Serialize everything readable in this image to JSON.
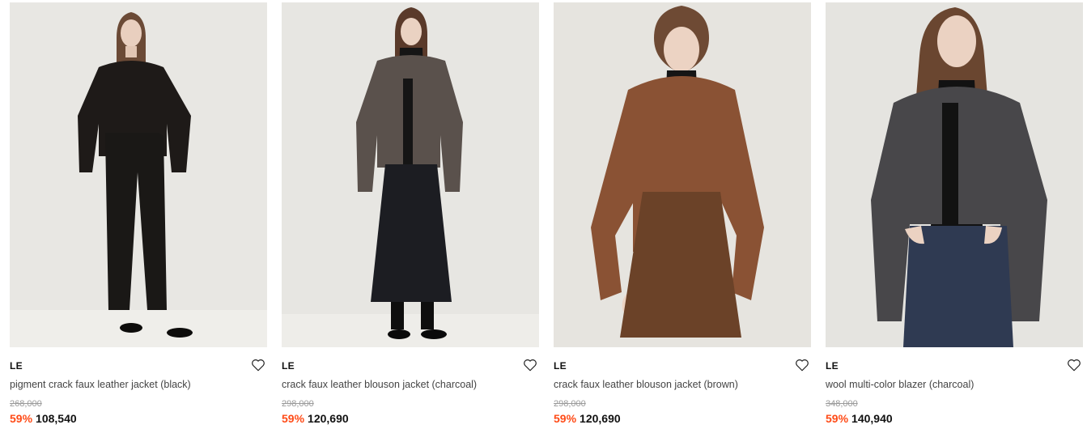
{
  "products": [
    {
      "brand": "LE",
      "name": "pigment crack faux leather jacket (black)",
      "original_price": "268,000",
      "discount": "59%",
      "price": "108,540",
      "wishlist_icon": "heart-outline-icon",
      "jacket_color": "#1e1a18",
      "bottom_color": "#1a1816",
      "backdrop_color": "#e8e7e3"
    },
    {
      "brand": "LE",
      "name": "crack faux leather blouson jacket (charcoal)",
      "original_price": "298,000",
      "discount": "59%",
      "price": "120,690",
      "wishlist_icon": "heart-outline-icon",
      "jacket_color": "#5a514c",
      "bottom_color": "#1c1d22",
      "backdrop_color": "#e7e6e2"
    },
    {
      "brand": "LE",
      "name": "crack faux leather blouson jacket (brown)",
      "original_price": "298,000",
      "discount": "59%",
      "price": "120,690",
      "wishlist_icon": "heart-outline-icon",
      "jacket_color": "#8a5234",
      "bottom_color": "#6b4228",
      "backdrop_color": "#e6e4df"
    },
    {
      "brand": "LE",
      "name": "wool multi-color blazer (charcoal)",
      "original_price": "348,000",
      "discount": "59%",
      "price": "140,940",
      "wishlist_icon": "heart-outline-icon",
      "jacket_color": "#48474a",
      "bottom_color": "#2f3a52",
      "backdrop_color": "#e5e4e0"
    }
  ],
  "colors": {
    "discount": "#ff4b17",
    "original_price": "#9a9a9a",
    "text": "#111111"
  }
}
